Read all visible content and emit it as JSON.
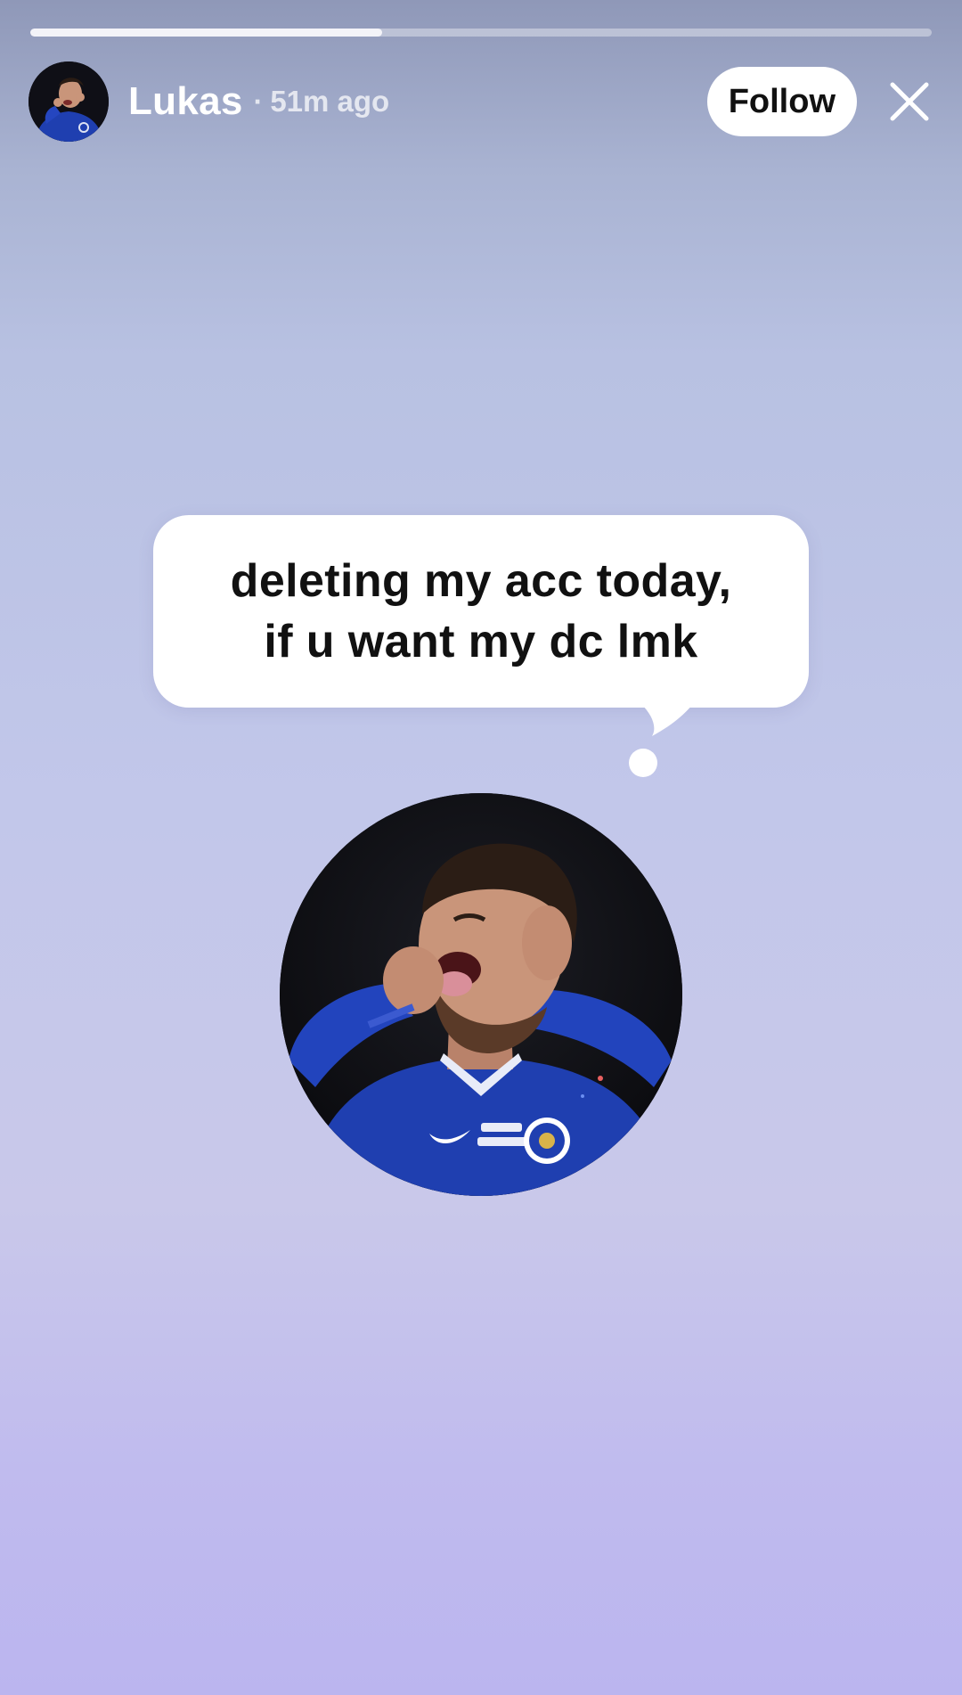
{
  "story": {
    "progress": 0.39
  },
  "header": {
    "user_name": "Lukas",
    "separator": "·",
    "time_ago": "51m ago",
    "follow_label": "Follow",
    "avatar_icon": "avatar-photo",
    "close_icon": "close-icon"
  },
  "bubble": {
    "line1": "deleting my acc today,",
    "line2": "if u want my dc lmk"
  },
  "photo": {
    "icon": "player-celebration-photo"
  },
  "colors": {
    "bubble": "#ffffff",
    "text": "#111111",
    "kit_blue": "#1f3fb0"
  }
}
